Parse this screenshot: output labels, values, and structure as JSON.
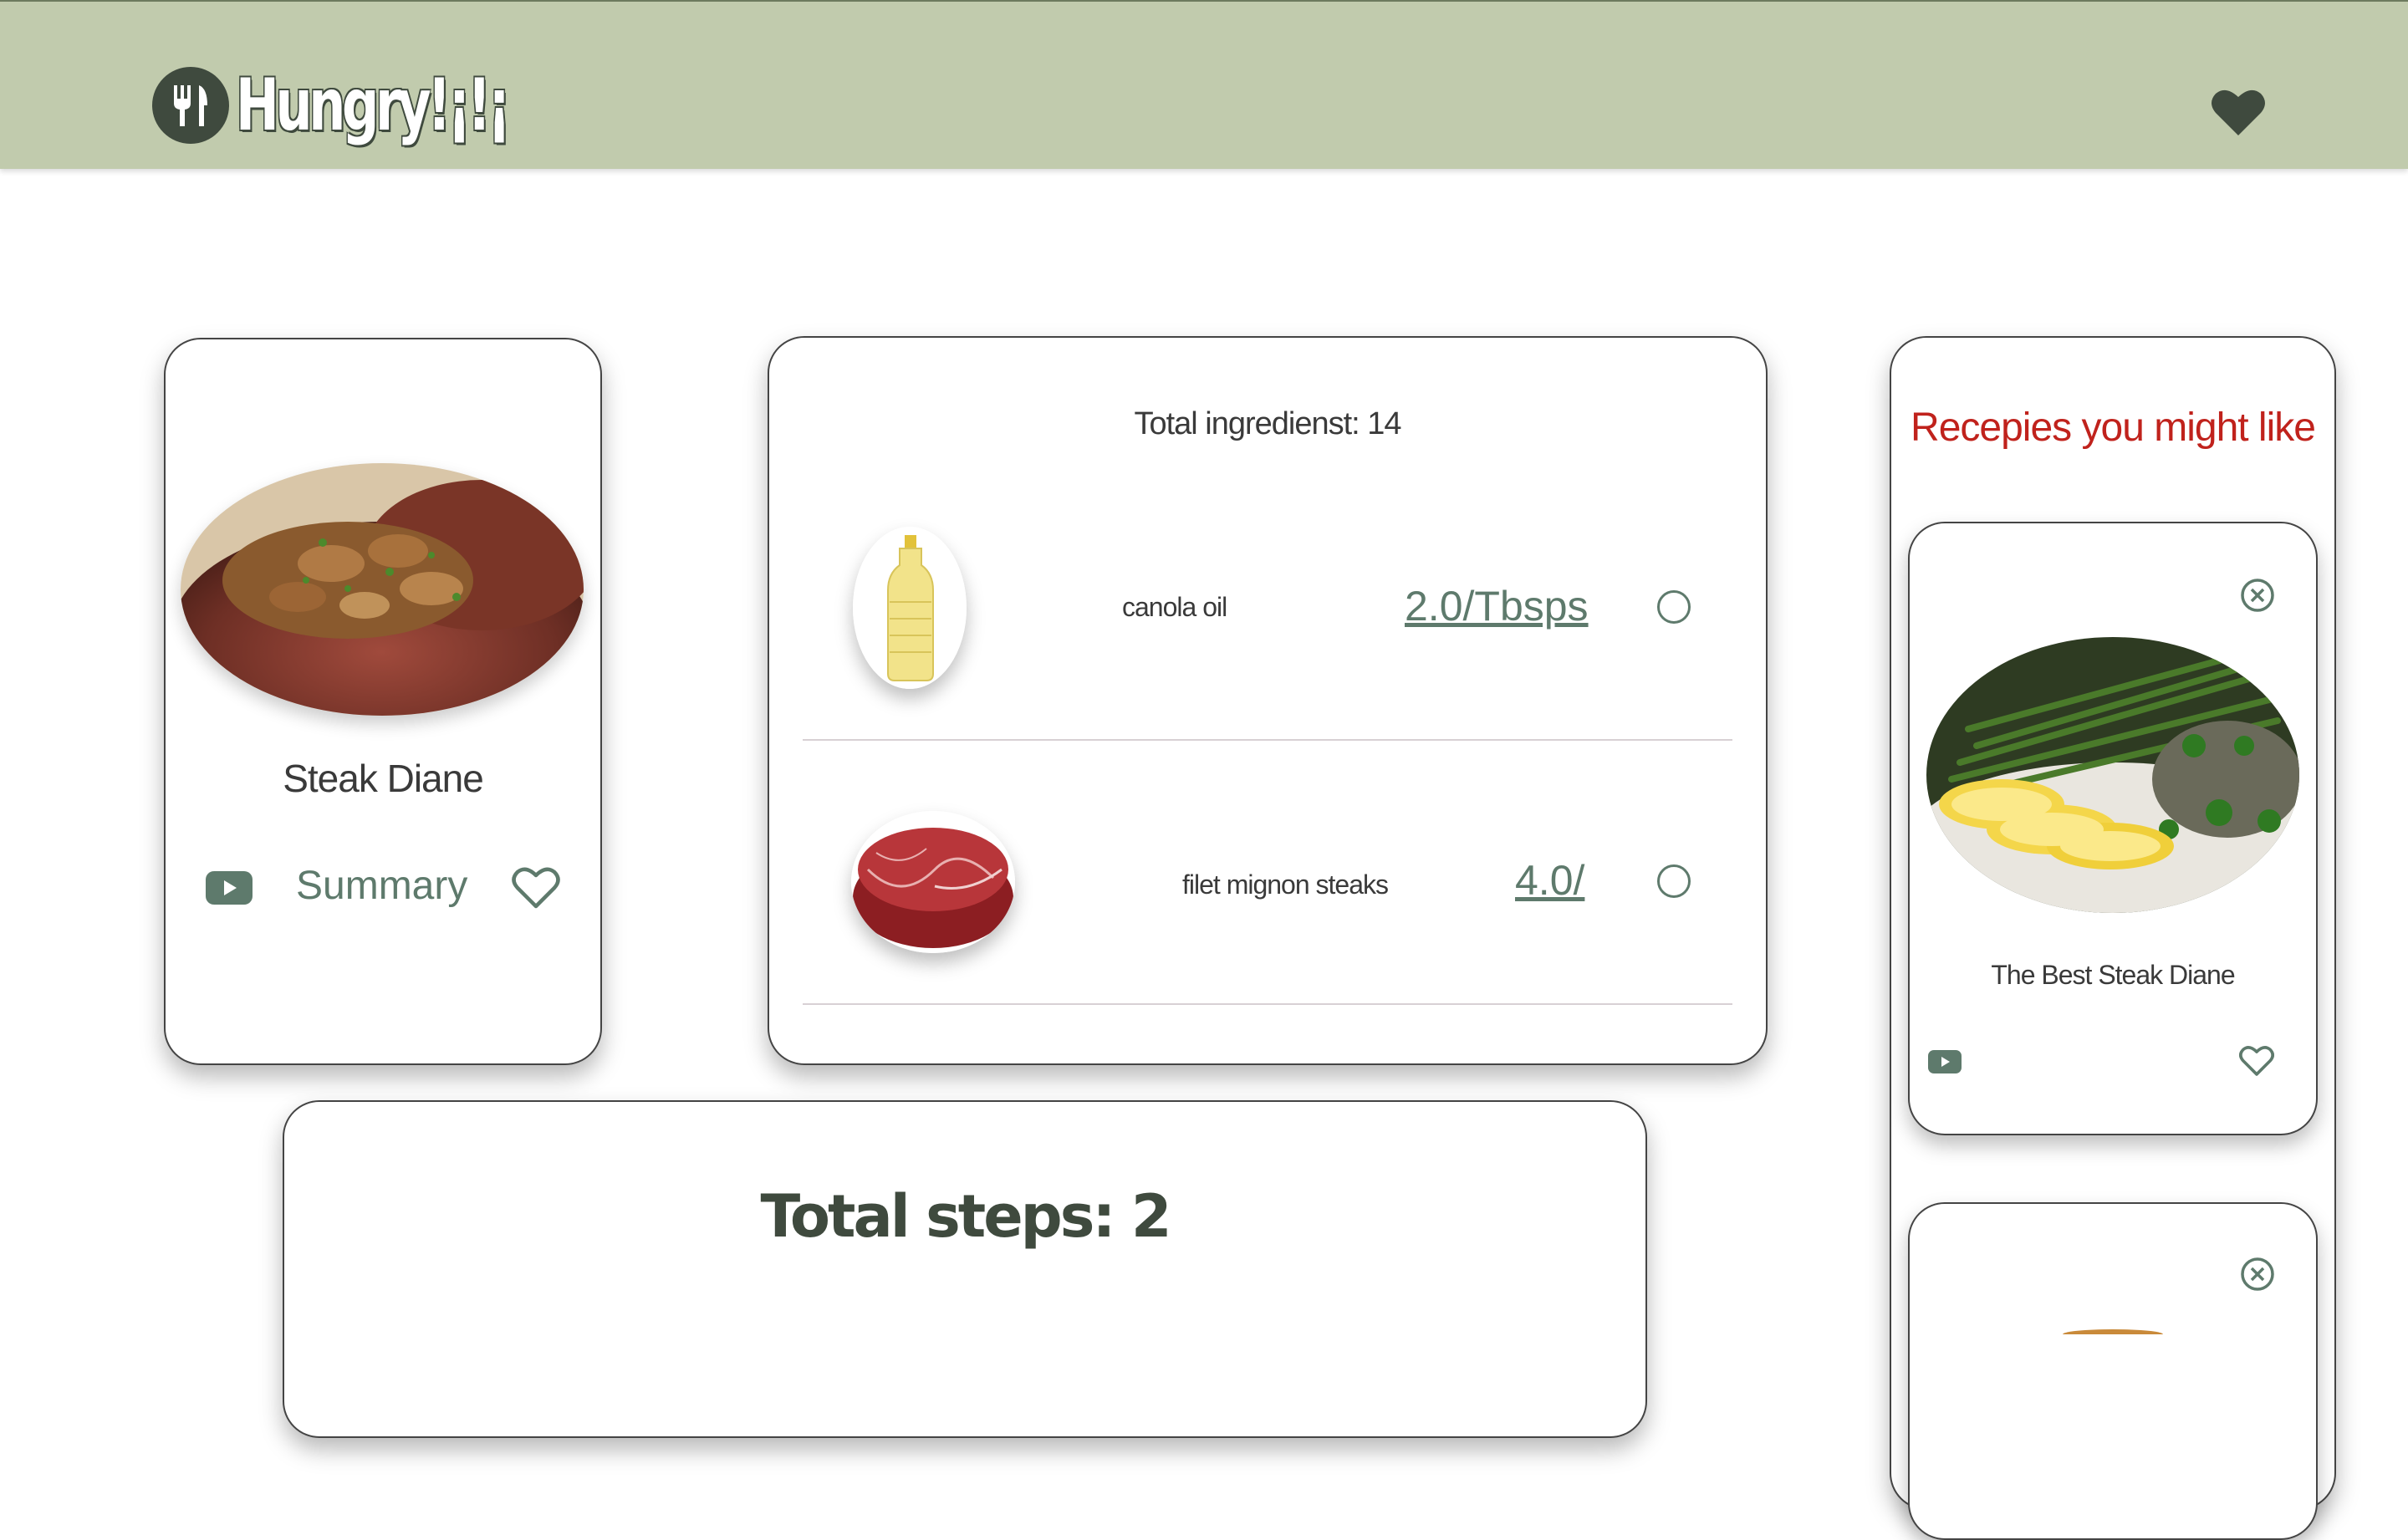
{
  "header": {
    "logo_text": "Hungry!¡!¡",
    "logo_icon": "fork-knife-icon",
    "favorites_icon": "heart-filled-icon"
  },
  "recipe": {
    "title": "Steak Diane",
    "summary_label": "Summary",
    "video_icon": "youtube-icon",
    "favorite_icon": "heart-outline-icon"
  },
  "ingredients": {
    "total_label": "Total ingredienst: 14",
    "items": [
      {
        "name": "canola oil",
        "amount": "2.0/Tbsps",
        "image": "oil-bottle"
      },
      {
        "name": "filet mignon steaks",
        "amount": "4.0/",
        "image": "raw-steak"
      }
    ]
  },
  "steps": {
    "total_label": "Total steps: 2"
  },
  "suggestions": {
    "title": "Recepies you might like",
    "items": [
      {
        "title": "The Best Steak Diane"
      },
      {
        "title": ""
      }
    ]
  },
  "colors": {
    "header_bg": "#c1cbad",
    "accent_green": "#5e7a6c",
    "dark_green": "#3f4a3e",
    "suggest_red": "#c0221c"
  }
}
